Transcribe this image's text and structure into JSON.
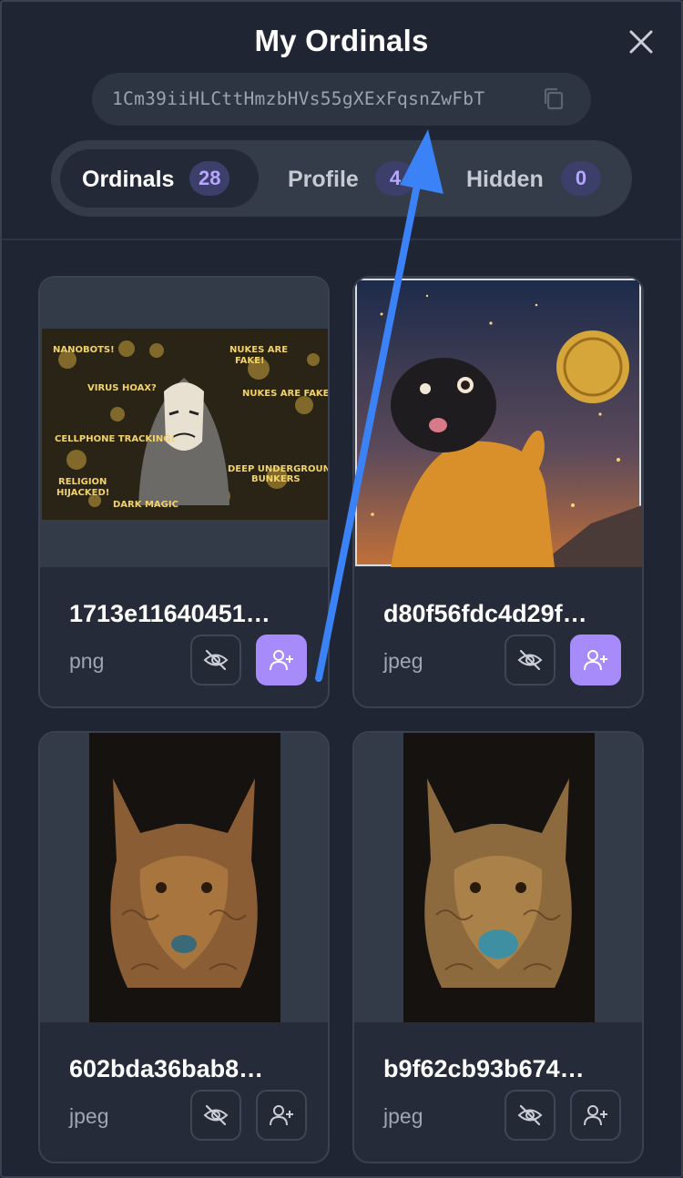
{
  "header": {
    "title": "My Ordinals",
    "address": "1Cm39iiHLCttHmzbHVs55gXExFqsnZwFbT"
  },
  "tabs": [
    {
      "label": "Ordinals",
      "count": "28",
      "active": true
    },
    {
      "label": "Profile",
      "count": "4",
      "active": false
    },
    {
      "label": "Hidden",
      "count": "0",
      "active": false
    }
  ],
  "cards": [
    {
      "title": "1713e11640451…",
      "type": "png",
      "image": "conspiracy-poster-hooded-figure",
      "assign_active": true
    },
    {
      "title": "d80f56fdc4d29f…",
      "type": "jpeg",
      "image": "pug-in-sweater-with-bsv-coin",
      "assign_active": true
    },
    {
      "title": "602bda36bab8…",
      "type": "jpeg",
      "image": "carved-wood-wolf-portrait",
      "assign_active": false
    },
    {
      "title": "b9f62cb93b674…",
      "type": "jpeg",
      "image": "carved-wood-wolf-blue-nose",
      "assign_active": false
    }
  ],
  "colors": {
    "background": "#1f2533",
    "accent": "#a78bfa",
    "count_text": "#b7a6ff",
    "annotation_arrow": "#3b82f6"
  }
}
